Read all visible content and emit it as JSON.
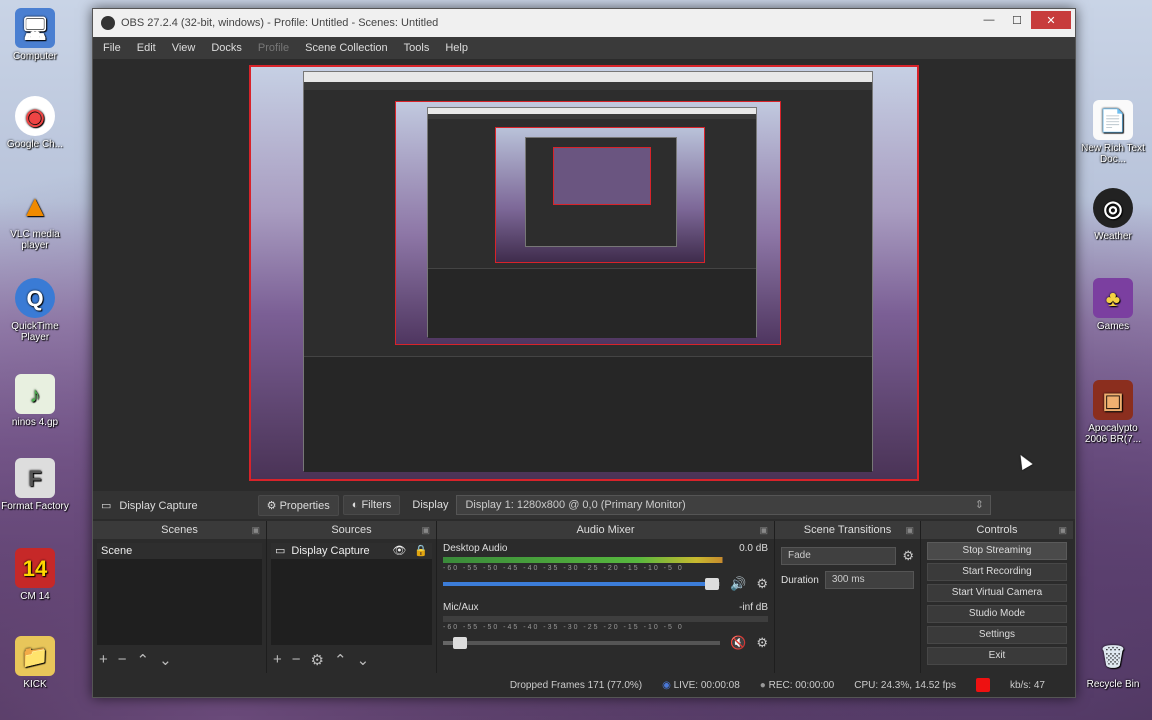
{
  "desktop": {
    "left_icons": [
      {
        "label": "Computer",
        "glyph": "🖥",
        "color": "#4a7fd1"
      },
      {
        "label": "Google Ch...",
        "glyph": "◉",
        "color": "#e44"
      },
      {
        "label": "VLC media player",
        "glyph": "▲",
        "color": "#f08a00"
      },
      {
        "label": "QuickTime Player",
        "glyph": "Q",
        "color": "#3a7bd5"
      },
      {
        "label": "ninos 4.gp",
        "glyph": "♪",
        "color": "#4caf50"
      },
      {
        "label": "Format Factory",
        "glyph": "F",
        "color": "#aaa"
      },
      {
        "label": "CM 14",
        "glyph": "14",
        "color": "#c62828"
      },
      {
        "label": "KICK",
        "glyph": "📁",
        "color": "#e8c65a"
      }
    ],
    "right_icons": [
      {
        "label": "New Rich Text Doc...",
        "glyph": "📄",
        "color": "#eee"
      },
      {
        "label": "Weather",
        "glyph": "◎",
        "color": "#222"
      },
      {
        "label": "Games",
        "glyph": "♣",
        "color": "#7b3fa0"
      },
      {
        "label": "Apocalypto 2006 BR(7...",
        "glyph": "▣",
        "color": "#8b2e1e"
      },
      {
        "label": "Recycle Bin",
        "glyph": "🗑",
        "color": "#9ab"
      }
    ]
  },
  "window": {
    "title": "OBS 27.2.4 (32-bit, windows) - Profile: Untitled - Scenes: Untitled",
    "min": "—",
    "max": "☐",
    "close": "✕"
  },
  "menu": [
    "File",
    "Edit",
    "View",
    "Docks",
    "Profile",
    "Scene Collection",
    "Tools",
    "Help"
  ],
  "source_toolbar": {
    "source_name": "Display Capture",
    "properties": "Properties",
    "filters": "Filters",
    "display_label": "Display",
    "display_value": "Display 1: 1280x800 @ 0,0 (Primary Monitor)"
  },
  "docks": {
    "scenes": {
      "title": "Scenes",
      "items": [
        "Scene"
      ]
    },
    "sources": {
      "title": "Sources",
      "items": [
        "Display Capture"
      ]
    },
    "mixer": {
      "title": "Audio Mixer",
      "channels": [
        {
          "name": "Desktop Audio",
          "db": "0.0 dB",
          "level": 0.86,
          "fader": 0.97
        },
        {
          "name": "Mic/Aux",
          "db": "-inf dB",
          "level": 0.0,
          "fader": 0.06
        }
      ],
      "ticks": "-60 -55 -50 -45 -40 -35 -30 -25 -20 -15 -10 -5 0"
    },
    "transitions": {
      "title": "Scene Transitions",
      "type": "Fade",
      "duration_label": "Duration",
      "duration_value": "300 ms"
    },
    "controls": {
      "title": "Controls",
      "buttons": [
        "Stop Streaming",
        "Start Recording",
        "Start Virtual Camera",
        "Studio Mode",
        "Settings",
        "Exit"
      ]
    }
  },
  "status": {
    "dropped": "Dropped Frames 171 (77.0%)",
    "live": "LIVE: 00:00:08",
    "rec": "REC: 00:00:00",
    "cpu": "CPU: 24.3%, 14.52 fps",
    "kbps": "kb/s: 47"
  }
}
